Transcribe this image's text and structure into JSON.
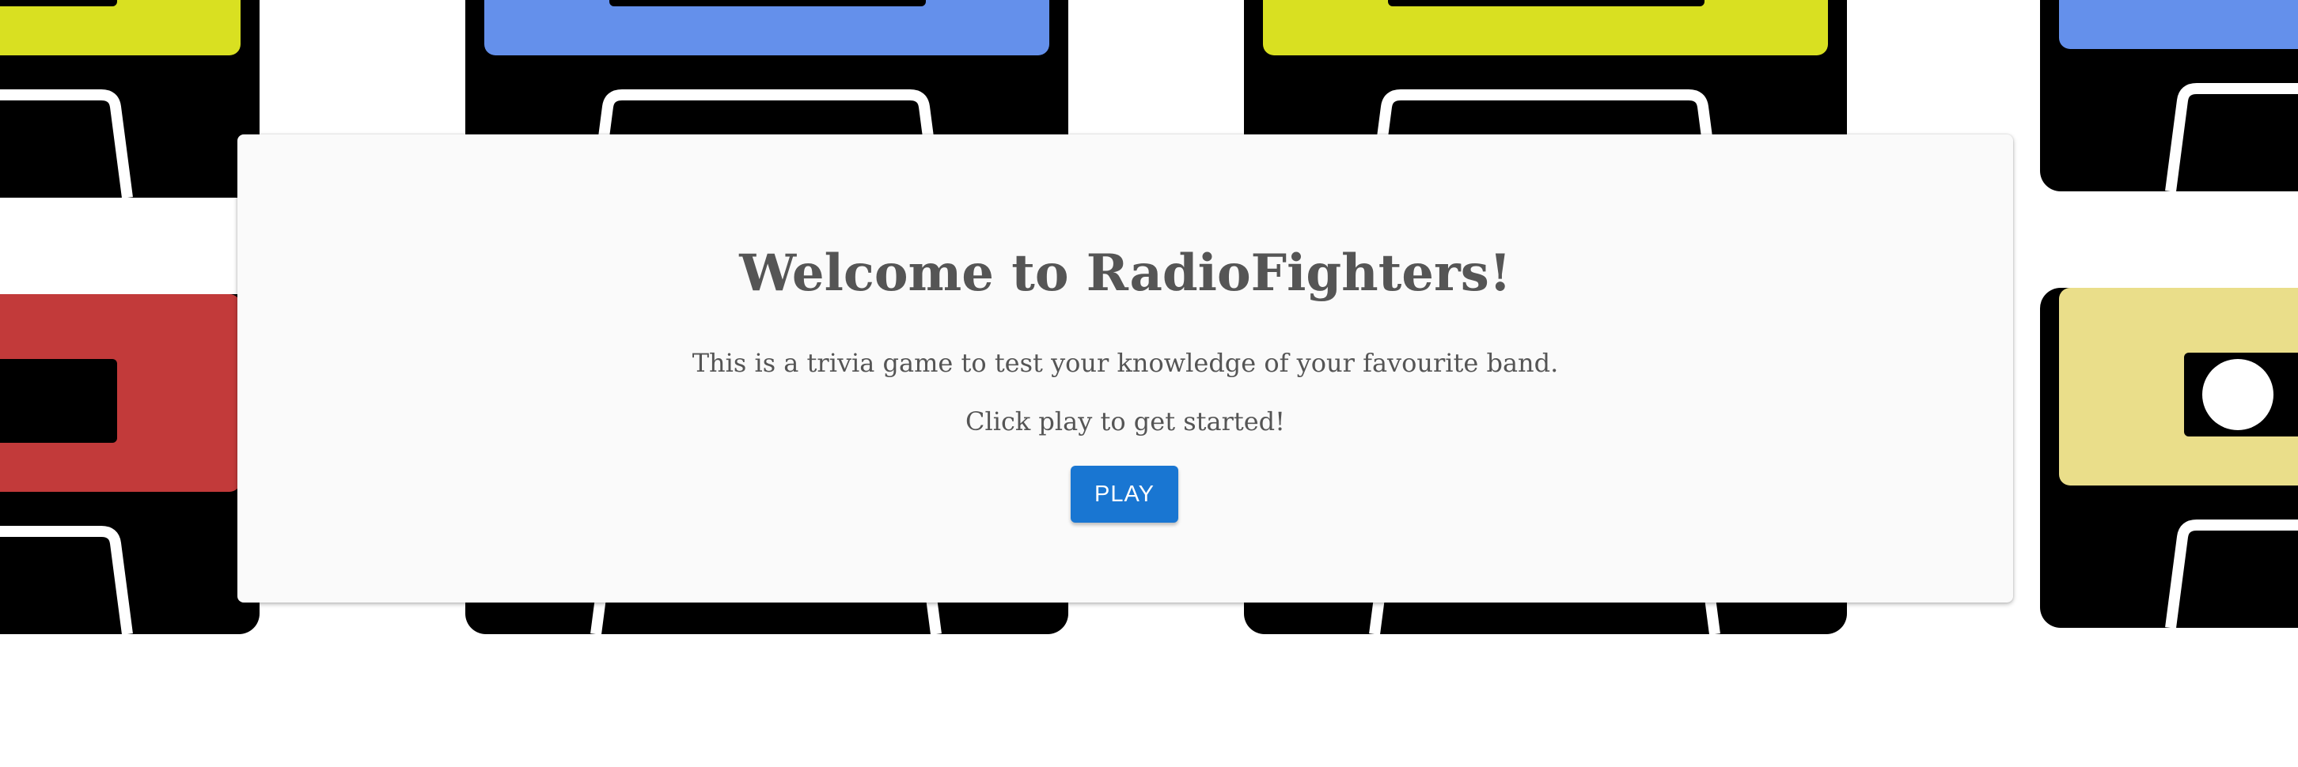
{
  "welcome": {
    "title": "Welcome to RadioFighters!",
    "description": "This is a trivia game to test your knowledge of your favourite band.",
    "instruction": "Click play to get started!",
    "play_label": "PLAY"
  },
  "background": {
    "cassette_colors": {
      "yellow": "#d9e021",
      "blue": "#6490eb",
      "red": "#c23a3a",
      "khaki": "#eade8a",
      "body": "#000000",
      "reel": "#ffffff"
    }
  },
  "theme": {
    "card": "#fafafa",
    "text": "#555555",
    "button": "#1976d2"
  }
}
